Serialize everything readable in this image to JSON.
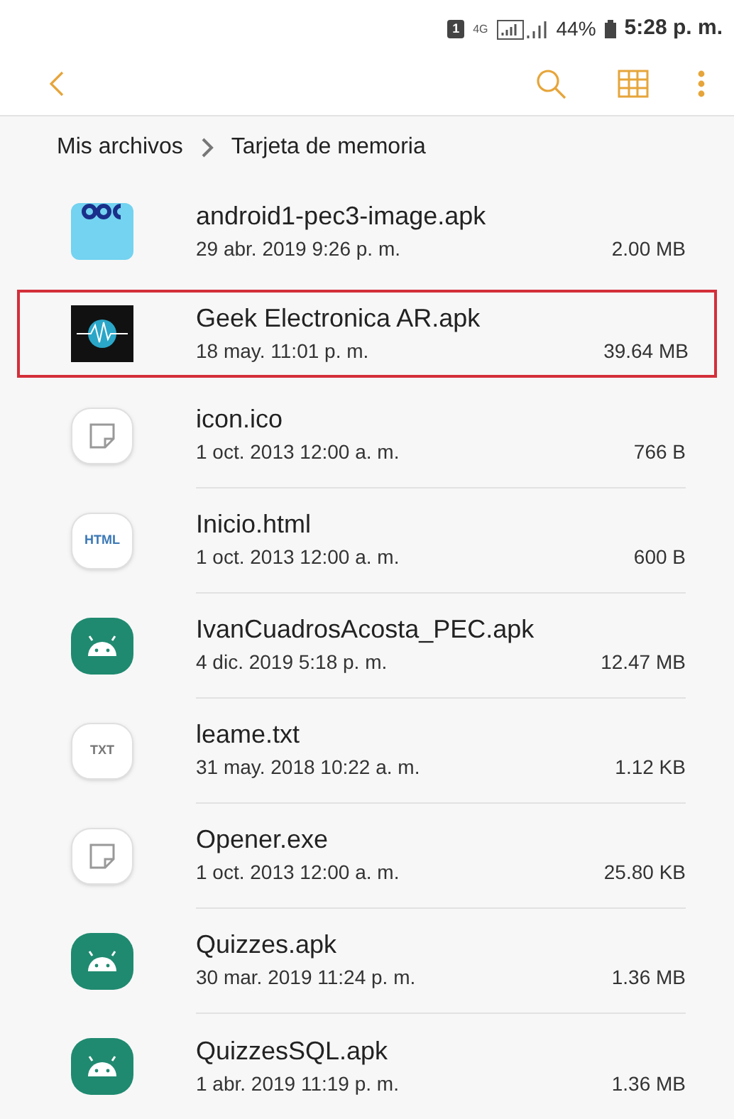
{
  "status_bar": {
    "sim": "1",
    "network": "4G",
    "battery": "44%",
    "time": "5:28 p. m."
  },
  "breadcrumb": [
    "Mis archivos",
    "Tarjeta de memoria"
  ],
  "files": [
    {
      "kind": "uoc",
      "name": "android1-pec3-image.apk",
      "date": "29 abr. 2019 9:26 p. m.",
      "size": "2.00 MB",
      "selected": false
    },
    {
      "kind": "image",
      "name": "Geek Electronica AR.apk",
      "date": "18 may. 11:01 p. m.",
      "size": "39.64 MB",
      "selected": true
    },
    {
      "kind": "file",
      "name": "icon.ico",
      "date": "1 oct. 2013 12:00 a. m.",
      "size": "766 B",
      "selected": false
    },
    {
      "kind": "html",
      "icon_label": "HTML",
      "name": "Inicio.html",
      "date": "1 oct. 2013 12:00 a. m.",
      "size": "600 B",
      "selected": false
    },
    {
      "kind": "android",
      "name": "IvanCuadrosAcosta_PEC.apk",
      "date": "4 dic. 2019 5:18 p. m.",
      "size": "12.47 MB",
      "selected": false
    },
    {
      "kind": "txt",
      "icon_label": "TXT",
      "name": "leame.txt",
      "date": "31 may. 2018 10:22 a. m.",
      "size": "1.12 KB",
      "selected": false
    },
    {
      "kind": "file",
      "name": "Opener.exe",
      "date": "1 oct. 2013 12:00 a. m.",
      "size": "25.80 KB",
      "selected": false
    },
    {
      "kind": "android",
      "name": "Quizzes.apk",
      "date": "30 mar. 2019 11:24 p. m.",
      "size": "1.36 MB",
      "selected": false
    },
    {
      "kind": "android",
      "name": "QuizzesSQL.apk",
      "date": "1 abr. 2019 11:19 p. m.",
      "size": "1.36 MB",
      "selected": false
    }
  ]
}
